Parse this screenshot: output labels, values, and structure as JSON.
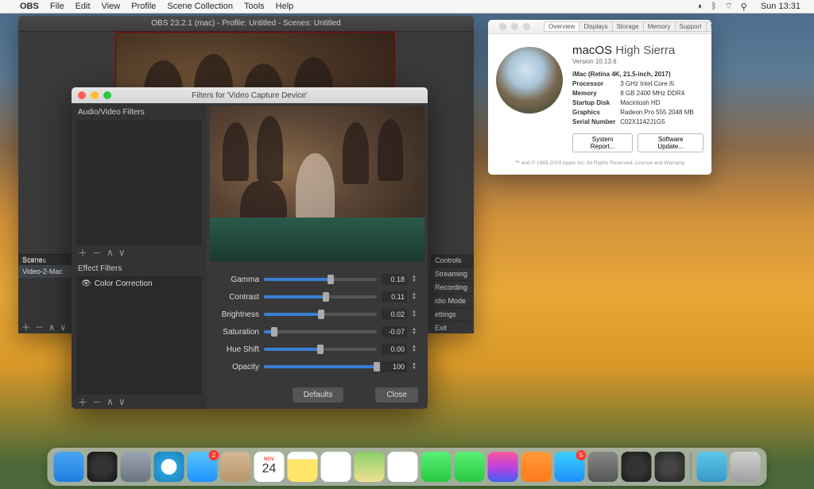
{
  "menubar": {
    "app": "OBS",
    "items": [
      "File",
      "Edit",
      "View",
      "Profile",
      "Scene Collection",
      "Tools",
      "Help"
    ],
    "clock": "Sun 13:31"
  },
  "obs": {
    "title": "OBS 23.2.1 (mac) - Profile: Untitled - Scenes: Untitled",
    "scenes_header": "Scenes",
    "scene_label": "Scene",
    "scene_item": "Video-2-Mac",
    "controls_header": "Controls",
    "controls": [
      "Streaming",
      "Recording",
      "idio Mode",
      "ettings",
      "Exit"
    ]
  },
  "filters": {
    "title": "Filters for 'Video Capture Device'",
    "av_label": "Audio/Video Filters",
    "effect_label": "Effect Filters",
    "effect_item": "Color Correction",
    "params": [
      {
        "label": "Gamma",
        "value": "0.18",
        "pct": 59
      },
      {
        "label": "Contrast",
        "value": "0.11",
        "pct": 55
      },
      {
        "label": "Brightness",
        "value": "0.02",
        "pct": 51
      },
      {
        "label": "Saturation",
        "value": "-0.07",
        "pct": 9
      },
      {
        "label": "Hue Shift",
        "value": "0.00",
        "pct": 50
      },
      {
        "label": "Opacity",
        "value": "100",
        "pct": 100
      }
    ],
    "btn_defaults": "Defaults",
    "btn_close": "Close"
  },
  "about": {
    "tabs": [
      "Overview",
      "Displays",
      "Storage",
      "Memory",
      "Support",
      "Service"
    ],
    "name": "macOS",
    "subname": "High Sierra",
    "version": "Version 10.13.6",
    "model": "iMac (Retina 4K, 21.5-inch, 2017)",
    "specs": [
      {
        "k": "Processor",
        "v": "3 GHz Intel Core i5"
      },
      {
        "k": "Memory",
        "v": "8 GB 2400 MHz DDR4"
      },
      {
        "k": "Startup Disk",
        "v": "Macintosh HD"
      },
      {
        "k": "Graphics",
        "v": "Radeon Pro 555 2048 MB"
      },
      {
        "k": "Serial Number",
        "v": "C02X1142J1G5"
      }
    ],
    "btn_report": "System Report...",
    "btn_update": "Software Update...",
    "footer": "™ and © 1983-2019 Apple Inc. All Rights Reserved. License and Warranty"
  },
  "dock": {
    "apps": [
      {
        "name": "finder",
        "bg": "linear-gradient(#4aa5f0,#1e7fe0)"
      },
      {
        "name": "siri",
        "bg": "radial-gradient(circle,#333 40%,#111 100%)"
      },
      {
        "name": "launchpad",
        "bg": "linear-gradient(#9aa5b0,#6a7580)"
      },
      {
        "name": "safari",
        "bg": "radial-gradient(circle,#fff 35%,#2a9fd6 38%,#1a7fc0 100%)"
      },
      {
        "name": "mail",
        "bg": "linear-gradient(#5ac8fa,#1e90ff)",
        "badge": "2"
      },
      {
        "name": "contacts",
        "bg": "linear-gradient(#d4b896,#b8956a)"
      },
      {
        "name": "calendar",
        "bg": "#fff",
        "text": "24",
        "textTop": "NOV"
      },
      {
        "name": "notes",
        "bg": "linear-gradient(#fff 25%,#ffe66a 25%)"
      },
      {
        "name": "reminders",
        "bg": "#fff"
      },
      {
        "name": "maps",
        "bg": "linear-gradient(#8ad06a,#f0e090)"
      },
      {
        "name": "photos",
        "bg": "#fff"
      },
      {
        "name": "messages",
        "bg": "linear-gradient(#5af078,#28c840)"
      },
      {
        "name": "facetime",
        "bg": "linear-gradient(#5af078,#28c840)"
      },
      {
        "name": "itunes",
        "bg": "linear-gradient(#fa5a9a,#c040e0,#4060f0)"
      },
      {
        "name": "ibooks",
        "bg": "linear-gradient(#ff9a3a,#ff7a1a)"
      },
      {
        "name": "appstore",
        "bg": "linear-gradient(#3ad0fa,#1e90ff)",
        "badge": "5"
      },
      {
        "name": "preferences",
        "bg": "linear-gradient(#888,#555)"
      },
      {
        "name": "quicktime",
        "bg": "radial-gradient(circle,#333 40%,#1a1a1a 100%)"
      },
      {
        "name": "obs",
        "bg": "radial-gradient(circle,#444 30%,#222 100%)"
      }
    ],
    "right": [
      {
        "name": "downloads",
        "bg": "linear-gradient(#5ac8e8,#3a98c8)"
      },
      {
        "name": "trash",
        "bg": "linear-gradient(#d0d0d0,#a0a0a0)"
      }
    ]
  }
}
